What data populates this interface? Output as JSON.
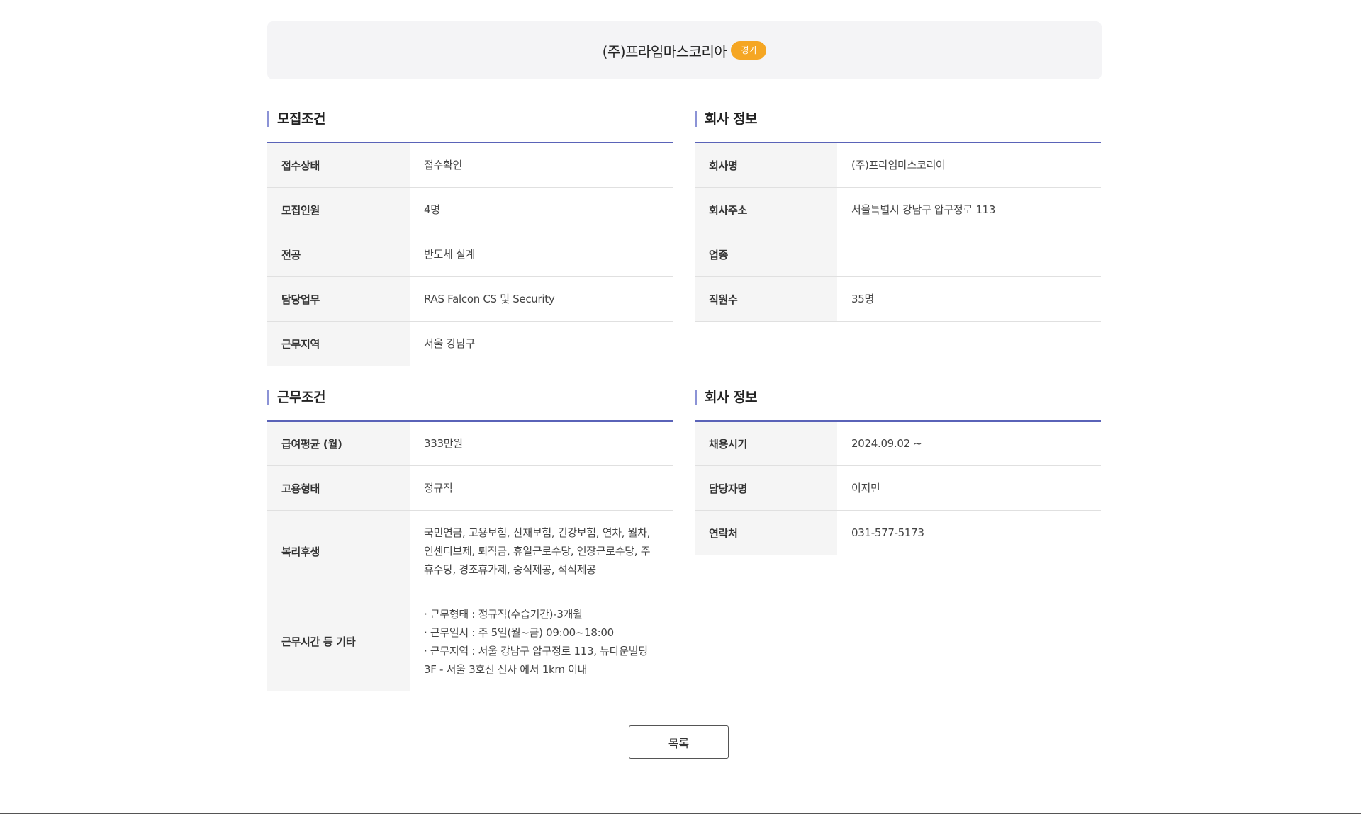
{
  "header": {
    "company_name": "(주)프라임마스코리아",
    "region_badge": "경기"
  },
  "recruit_conditions": {
    "title": "모집조건",
    "rows": [
      {
        "label": "접수상태",
        "value": "접수확인"
      },
      {
        "label": "모집인원",
        "value": "4명"
      },
      {
        "label": "전공",
        "value": "반도체 설계"
      },
      {
        "label": "담당업무",
        "value": "RAS Falcon CS 및 Security"
      },
      {
        "label": "근무지역",
        "value": "서울 강남구"
      }
    ]
  },
  "company_info": {
    "title": "회사 정보",
    "rows": [
      {
        "label": "회사명",
        "value": "(주)프라임마스코리아"
      },
      {
        "label": "회사주소",
        "value": "서울특별시 강남구 압구정로 113"
      },
      {
        "label": "업종",
        "value": ""
      },
      {
        "label": "직원수",
        "value": "35명"
      }
    ]
  },
  "work_conditions": {
    "title": "근무조건",
    "rows": [
      {
        "label": "급여평균 (월)",
        "value": "333만원"
      },
      {
        "label": "고용형태",
        "value": "정규직"
      },
      {
        "label": "복리후생",
        "value": "국민연금, 고용보험, 산재보험, 건강보험, 연차, 월차,\n인센티브제, 퇴직금, 휴일근로수당, 연장근로수당, 주\n휴수당, 경조휴가제, 중식제공, 석식제공"
      },
      {
        "label": "근무시간 등 기타",
        "value": " · 근무형태 : 정규직(수습기간)-3개월\n · 근무일시 : 주 5일(월~금) 09:00~18:00\n · 근무지역 : 서울 강남구 압구정로 113, 뉴타운빌딩\n3F - 서울 3호선 신사 에서 1km 이내"
      }
    ]
  },
  "contact_info": {
    "title": "회사 정보",
    "rows": [
      {
        "label": "채용시기",
        "value": "2024.09.02 ~"
      },
      {
        "label": "담당자명",
        "value": "이지민"
      },
      {
        "label": "연락처",
        "value": "031-577-5173"
      }
    ]
  },
  "actions": {
    "list_button": "목록"
  }
}
